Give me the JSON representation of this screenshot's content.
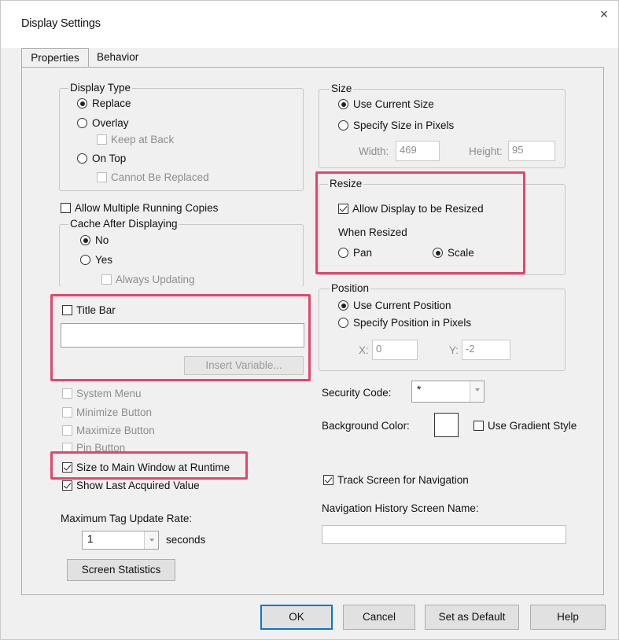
{
  "window": {
    "title": "Display Settings",
    "close_glyph": "×"
  },
  "tabs": [
    {
      "label": "Properties",
      "active": true
    },
    {
      "label": "Behavior",
      "active": false
    }
  ],
  "display_type": {
    "title": "Display Type",
    "replace": "Replace",
    "overlay": "Overlay",
    "keep_at_back": "Keep at Back",
    "on_top": "On Top",
    "cannot_be_replaced": "Cannot Be Replaced",
    "selected": "Replace"
  },
  "allow_multiple": {
    "label": "Allow Multiple Running Copies",
    "checked": false
  },
  "cache": {
    "title": "Cache After Displaying",
    "no": "No",
    "yes": "Yes",
    "always_updating": "Always Updating",
    "selected": "No"
  },
  "title_bar": {
    "label": "Title Bar",
    "checked": false,
    "value": "",
    "insert_variable": "Insert Variable..."
  },
  "window_options": {
    "system_menu": "System Menu",
    "minimize_button": "Minimize Button",
    "maximize_button": "Maximize Button",
    "pin_button": "Pin Button",
    "size_to_main": "Size to Main Window at Runtime",
    "show_last_acquired": "Show Last Acquired Value"
  },
  "update_rate": {
    "label": "Maximum Tag Update Rate:",
    "value": "1",
    "unit": "seconds"
  },
  "screen_statistics": "Screen Statistics",
  "size": {
    "title": "Size",
    "use_current": "Use Current Size",
    "specify": "Specify Size in Pixels",
    "width_label": "Width:",
    "width_value": "469",
    "height_label": "Height:",
    "height_value": "95",
    "selected": "Use Current Size"
  },
  "resize": {
    "title": "Resize",
    "allow": "Allow Display to be Resized",
    "when_resized": "When Resized",
    "pan": "Pan",
    "scale": "Scale",
    "selected": "Scale"
  },
  "position": {
    "title": "Position",
    "use_current": "Use Current Position",
    "specify": "Specify Position in Pixels",
    "x_label": "X:",
    "x_value": "0",
    "y_label": "Y:",
    "y_value": "-2",
    "selected": "Use Current Position"
  },
  "security": {
    "label": "Security Code:",
    "value": "*"
  },
  "background": {
    "label": "Background Color:",
    "color": "#ffffff",
    "gradient_label": "Use Gradient Style"
  },
  "navigation": {
    "track_label": "Track Screen for Navigation",
    "history_label": "Navigation History Screen Name:",
    "history_value": ""
  },
  "buttons": {
    "ok": "OK",
    "cancel": "Cancel",
    "set_default": "Set as Default",
    "help": "Help"
  },
  "colors": {
    "highlight": "#e8436b",
    "dialog_bg": "#f0f0f0"
  }
}
